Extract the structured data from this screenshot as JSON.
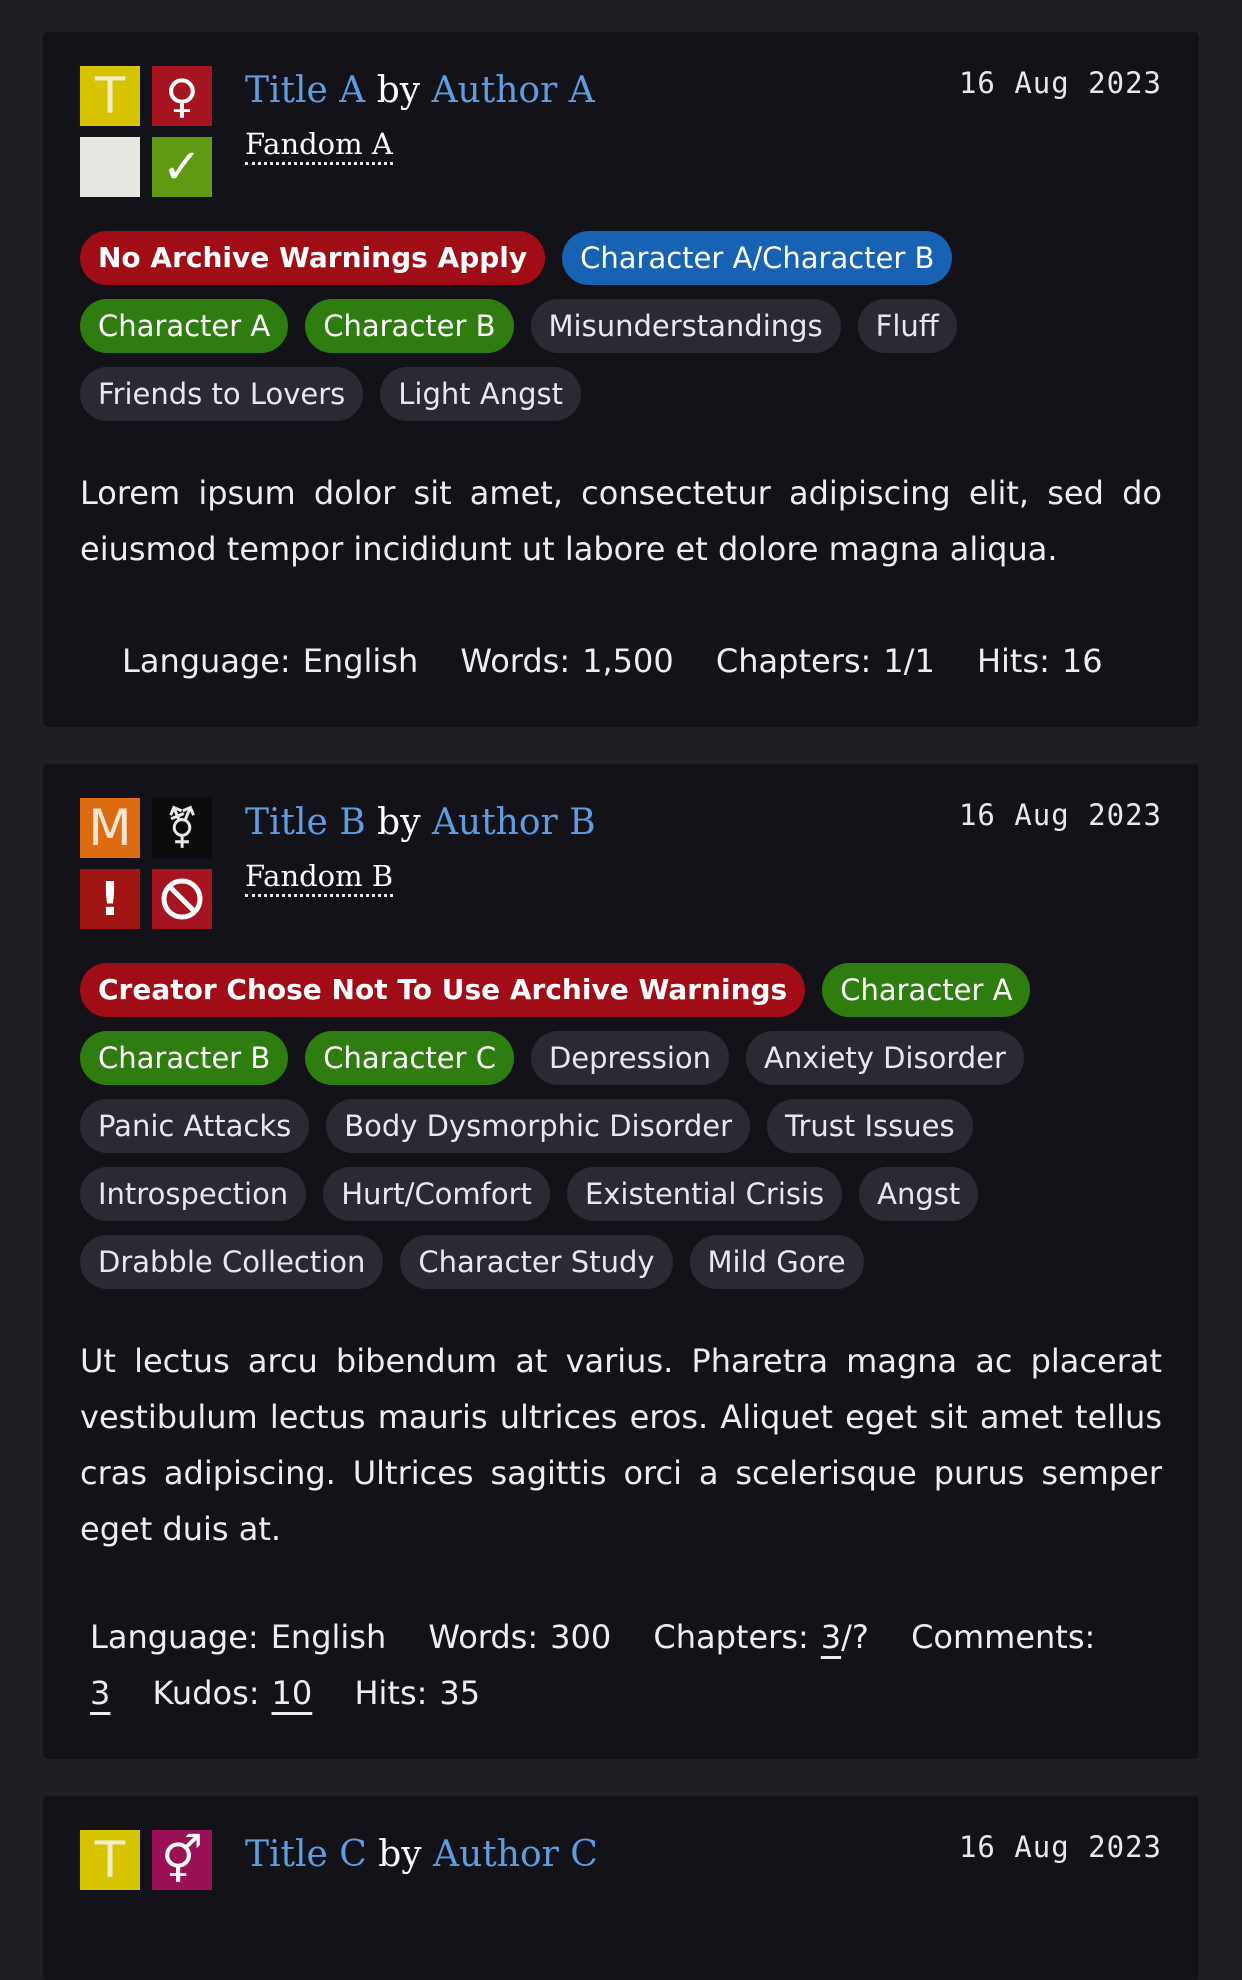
{
  "works": [
    {
      "icons": [
        {
          "name": "rating-teen-icon",
          "glyph": "T",
          "color": "#d6c401"
        },
        {
          "name": "category-female-icon",
          "glyph": "♀",
          "color": "#a61422"
        },
        {
          "name": "warnings-none-icon",
          "glyph": "",
          "color": "#e9e7e2"
        },
        {
          "name": "complete-check-icon",
          "glyph": "✓",
          "color": "#5f9a12"
        }
      ],
      "title": "Title A",
      "by": "by",
      "author": "Author A",
      "date": "16 Aug 2023",
      "fandom": "Fandom A",
      "tags": {
        "warnings": [
          "No Archive Warnings Apply"
        ],
        "relationships": [
          "Character A/Character B"
        ],
        "characters": [
          "Character A",
          "Character B"
        ],
        "freeform": [
          "Misunderstandings",
          "Fluff",
          "Friends to Lovers",
          "Light Angst"
        ]
      },
      "summary": "Lorem ipsum dolor sit amet, consectetur adipiscing elit, sed do eiusmod tempor incididunt ut labore et dolore magna aliqua.",
      "stats": {
        "language_label": "Language:",
        "language": "English",
        "words_label": "Words:",
        "words": "1,500",
        "chapters_label": "Chapters:",
        "chapters": "1/1",
        "hits_label": "Hits:",
        "hits": "16"
      }
    },
    {
      "icons": [
        {
          "name": "rating-mature-icon",
          "glyph": "M",
          "color": "#dc6b12"
        },
        {
          "name": "category-multi-icon",
          "glyph": "⚧",
          "color": "#0b0b0b"
        },
        {
          "name": "warnings-exclamation-icon",
          "glyph": "!",
          "color": "#a21515"
        },
        {
          "name": "incomplete-prohibited-icon",
          "glyph": "⃠",
          "color": "#a21515"
        }
      ],
      "title": "Title B",
      "by": "by",
      "author": "Author B",
      "date": "16 Aug 2023",
      "fandom": "Fandom B",
      "tags": {
        "warnings": [
          "Creator Chose Not To Use Archive Warnings"
        ],
        "characters": [
          "Character A",
          "Character B",
          "Character C"
        ],
        "freeform": [
          "Depression",
          "Anxiety Disorder",
          "Panic Attacks",
          "Body Dysmorphic Disorder",
          "Trust Issues",
          "Introspection",
          "Hurt/Comfort",
          "Existential Crisis",
          "Angst",
          "Drabble Collection",
          "Character Study",
          "Mild Gore"
        ]
      },
      "summary": "Ut lectus arcu bibendum at varius. Pharetra magna ac placerat vestibulum lectus mauris ultrices eros. Aliquet eget sit amet tellus cras adipiscing. Ultrices sagittis orci a scelerisque purus semper eget duis at.",
      "stats": {
        "language_label": "Language:",
        "language": "English",
        "words_label": "Words:",
        "words": "300",
        "chapters_label": "Chapters:",
        "chapters_current": "3",
        "chapters_total": "/?",
        "comments_label": "Comments:",
        "comments": "3",
        "kudos_label": "Kudos:",
        "kudos": "10",
        "hits_label": "Hits:",
        "hits": "35"
      }
    },
    {
      "icons": [
        {
          "name": "rating-teen-icon",
          "glyph": "T",
          "color": "#d6c401"
        },
        {
          "name": "category-mixed-icon",
          "glyph": "⚥",
          "color": "#9a1057"
        }
      ],
      "title": "Title C",
      "by": "by",
      "author": "Author C",
      "date": "16 Aug 2023"
    }
  ]
}
